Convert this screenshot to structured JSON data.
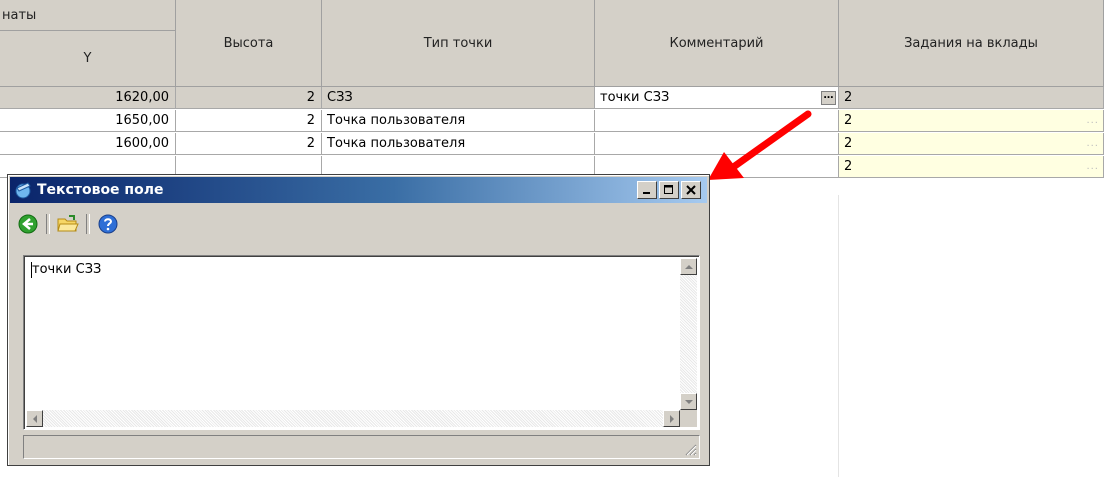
{
  "grid": {
    "header": {
      "group_label": "наты",
      "y_label": "Y",
      "height_label": "Высота",
      "point_type_label": "Тип точки",
      "comment_label": "Комментарий",
      "tasks_label": "Задания на вклады"
    },
    "rows": [
      {
        "y": "1620,00",
        "height": "2",
        "type": "СЗЗ",
        "comment": "точки СЗЗ",
        "tasks": "2"
      },
      {
        "y": "1650,00",
        "height": "2",
        "type": "Точка пользователя",
        "comment": "",
        "tasks": "2"
      },
      {
        "y": "1600,00",
        "height": "2",
        "type": "Точка пользователя",
        "comment": "",
        "tasks": "2"
      },
      {
        "y": "",
        "height": "",
        "type": "",
        "comment": "",
        "tasks": "2"
      }
    ],
    "ellipsis": "…",
    "tasks_dots": "..."
  },
  "dialog": {
    "title": "Текстовое поле",
    "title_icon": "text-field-app-icon",
    "toolbar": [
      "back-icon",
      "open-folder-icon",
      "help-icon"
    ],
    "content": "точки СЗЗ"
  },
  "colors": {
    "arrow": "#ff0000",
    "title_start": "#0a246a",
    "title_end": "#a6caf0",
    "selected_row": "#d4d0c8",
    "tasks_cell": "#ffffe1"
  }
}
